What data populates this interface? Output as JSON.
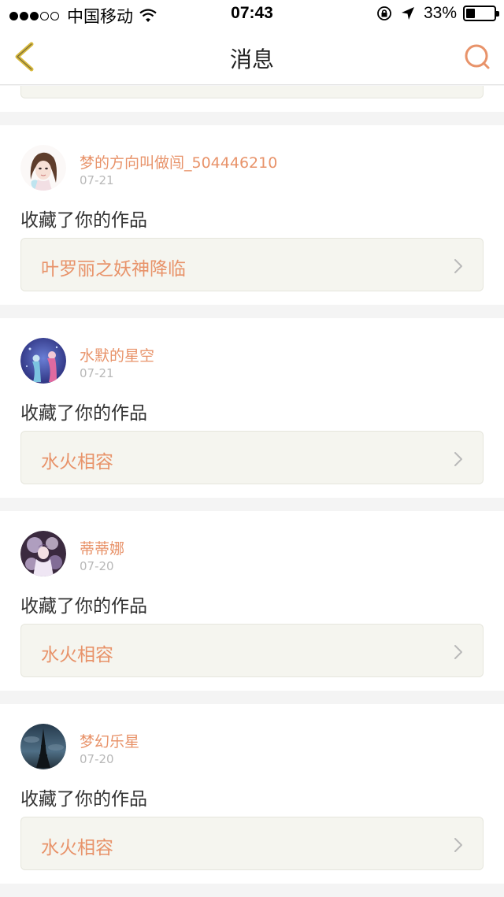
{
  "status_bar": {
    "carrier": "中国移动",
    "time": "07:43",
    "battery": "33%",
    "battery_level": 0.33,
    "signal_bars": 3,
    "signal_total": 5
  },
  "nav": {
    "title": "消息",
    "back_icon": "chevron-left-icon",
    "search_icon": "search-icon"
  },
  "colors": {
    "accent": "#e8936a",
    "back_icon": "#d8b93c"
  },
  "notifications": [
    {
      "user": "梦的方向叫做闯_504446210",
      "date": "07-21",
      "action": "收藏了你的作品",
      "work": "叶罗丽之妖神降临"
    },
    {
      "user": "水默的星空",
      "date": "07-21",
      "action": "收藏了你的作品",
      "work": "水火相容"
    },
    {
      "user": "蒂蒂娜",
      "date": "07-20",
      "action": "收藏了你的作品",
      "work": "水火相容"
    },
    {
      "user": "梦幻乐星",
      "date": "07-20",
      "action": "收藏了你的作品",
      "work": "水火相容"
    }
  ]
}
